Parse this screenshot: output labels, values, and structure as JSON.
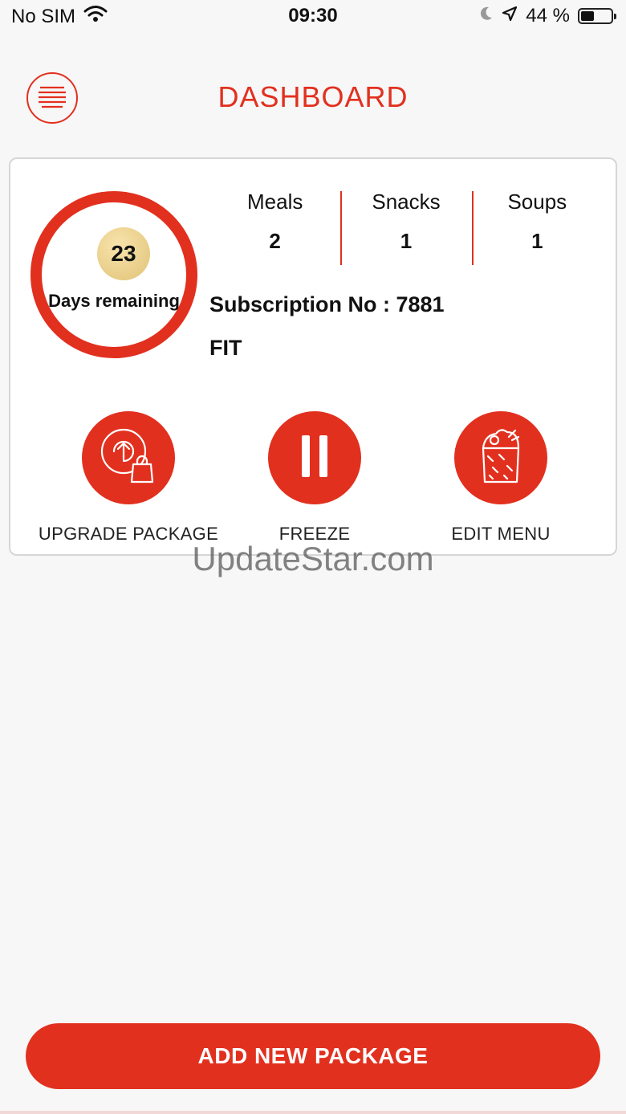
{
  "status_bar": {
    "carrier": "No SIM",
    "time": "09:30",
    "battery_percent_text": "44 %",
    "battery_level": 0.44,
    "icons": [
      "wifi-icon",
      "moon-icon",
      "location-arrow-icon",
      "battery-icon"
    ]
  },
  "header": {
    "title": "DASHBOARD",
    "menu_icon": "hamburger-menu-icon"
  },
  "subscription": {
    "days_remaining": "23",
    "days_label": "Days remaining",
    "stats": [
      {
        "name": "Meals",
        "value": "2"
      },
      {
        "name": "Snacks",
        "value": "1"
      },
      {
        "name": "Soups",
        "value": "1"
      }
    ],
    "subscription_label": "Subscription No : 7881",
    "plan_name": "FIT"
  },
  "actions": [
    {
      "label": "UPGRADE PACKAGE",
      "icon": "upgrade-shopping-bag-icon"
    },
    {
      "label": "FREEZE",
      "icon": "pause-icon"
    },
    {
      "label": "EDIT MENU",
      "icon": "wrap-food-icon"
    }
  ],
  "watermark": "UpdateStar.com",
  "footer": {
    "add_button_label": "ADD NEW PACKAGE"
  },
  "colors": {
    "accent": "#e2301f",
    "badge_gold": "#e9d08f",
    "background": "#f7f7f7"
  }
}
